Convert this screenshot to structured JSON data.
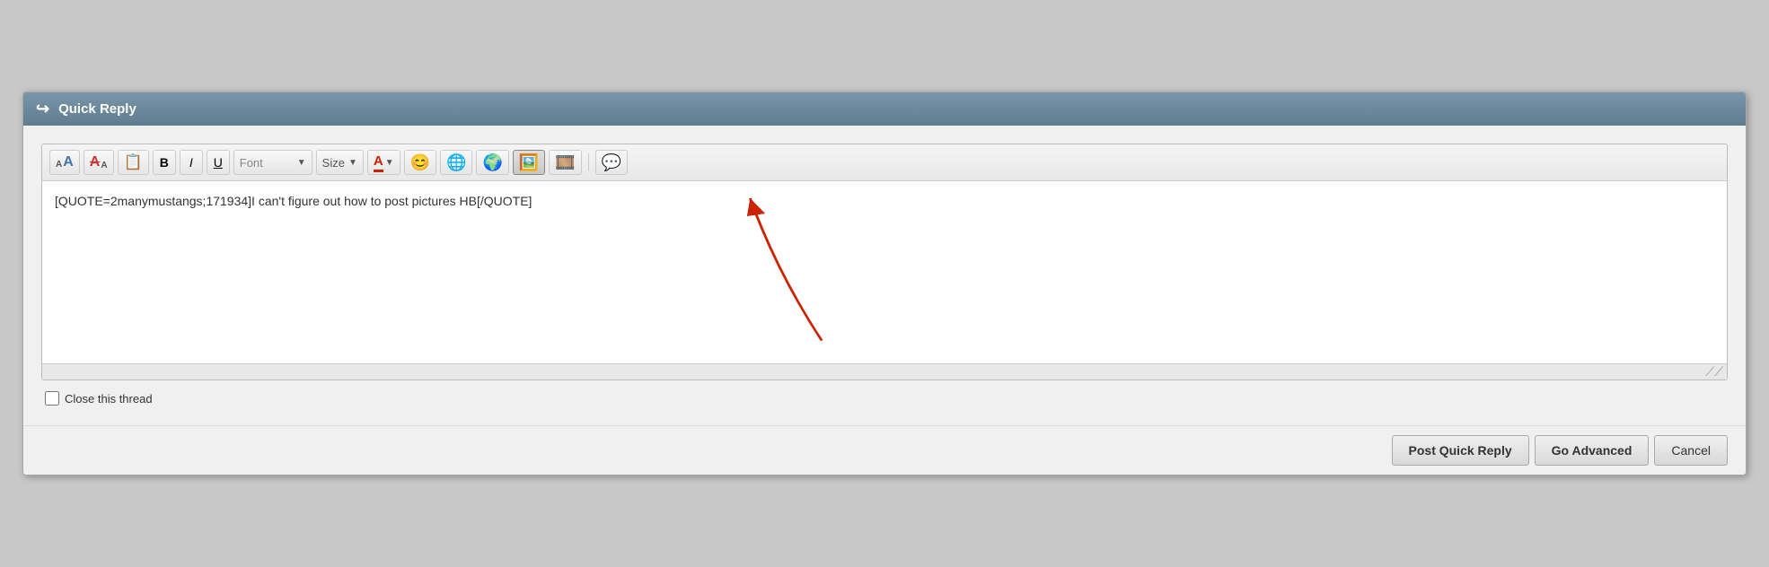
{
  "header": {
    "icon": "↩",
    "title": "Quick Reply"
  },
  "toolbar": {
    "buttons": [
      {
        "id": "font-size-small",
        "label": "A",
        "type": "font-small"
      },
      {
        "id": "font-size-large",
        "label": "A",
        "type": "font-large"
      },
      {
        "id": "paint",
        "label": "🖼",
        "type": "image"
      },
      {
        "id": "bold",
        "label": "B",
        "type": "bold"
      },
      {
        "id": "italic",
        "label": "I",
        "type": "italic"
      },
      {
        "id": "underline",
        "label": "U",
        "type": "underline"
      }
    ],
    "font_label": "Font",
    "size_label": "Size",
    "color_label": "A",
    "emoji_label": "😊",
    "icons": [
      "globe",
      "globe2",
      "image-insert",
      "film",
      "speech"
    ]
  },
  "editor": {
    "content": "[QUOTE=2manymustangs;171934]I can't figure out how to post pictures HB[/QUOTE]",
    "placeholder": ""
  },
  "options": {
    "close_thread_label": "Close this thread"
  },
  "footer": {
    "post_quick_reply_label": "Post Quick Reply",
    "go_advanced_label": "Go Advanced",
    "cancel_label": "Cancel"
  },
  "annotation": {
    "arrow_color": "#cc2200"
  }
}
